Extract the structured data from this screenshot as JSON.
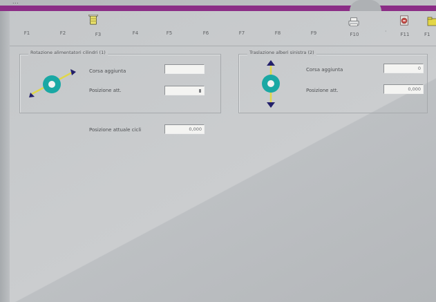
{
  "window": {
    "title": "...",
    "accent_color": "#8b2d86"
  },
  "toolbar": {
    "keys": [
      {
        "label": "F1",
        "icon": null,
        "active": false
      },
      {
        "label": "F2",
        "icon": null,
        "active": false
      },
      {
        "label": "F3",
        "icon": "cylinder-icon",
        "active": true
      },
      {
        "label": "F4",
        "icon": null,
        "active": false
      },
      {
        "label": "F5",
        "icon": null,
        "active": false
      },
      {
        "label": "F6",
        "icon": null,
        "active": false
      },
      {
        "label": "F7",
        "icon": null,
        "active": false
      },
      {
        "label": "F8",
        "icon": null,
        "active": false
      },
      {
        "label": "F9",
        "icon": null,
        "active": false
      },
      {
        "label": "F10",
        "icon": "print-icon",
        "active": false
      },
      {
        "label": "F11",
        "icon": "exit-icon",
        "active": false
      },
      {
        "label": "F1",
        "icon": "folder-icon",
        "active": false
      }
    ]
  },
  "left_group": {
    "title": "Rotazione alimentatori cilindri (1)",
    "row1_label": "Corsa aggiunta",
    "row1_value": "",
    "row2_label": "Posizione att.",
    "row2_value": "",
    "extra_label": "Posizione attuale cicli",
    "extra_value": "0,000"
  },
  "right_group": {
    "title": "Traslazione alberi sinistra (2)",
    "row1_label": "Corsa aggiunta",
    "row1_value": "0",
    "row2_label": "Posizione att.",
    "row2_value": "0,000"
  }
}
